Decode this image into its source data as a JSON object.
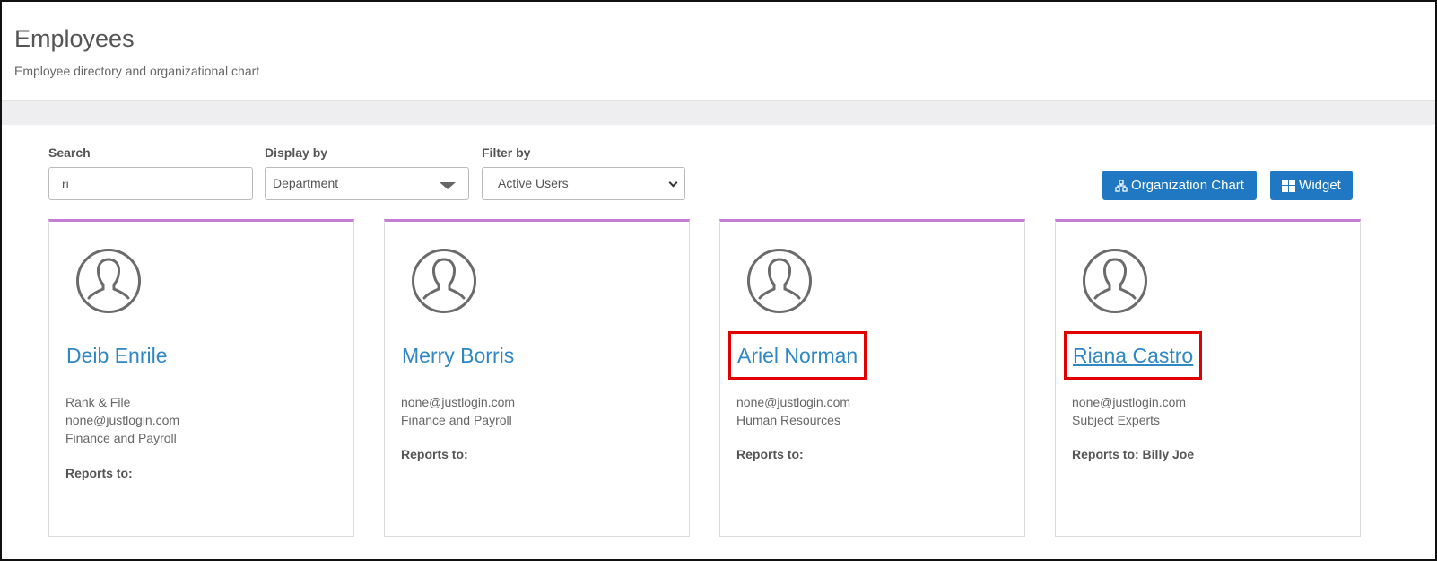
{
  "header": {
    "title": "Employees",
    "subtitle": "Employee directory and organizational chart"
  },
  "filters": {
    "search_label": "Search",
    "search_value": "ri",
    "display_label": "Display by",
    "display_value": "Department",
    "filter_label": "Filter by",
    "filter_value": "Active Users"
  },
  "actions": {
    "org_chart_label": "Organization Chart",
    "widget_label": "Widget"
  },
  "colors": {
    "accent": "#1f78c1",
    "card_top_border": "#c47fd4",
    "name_link": "#2f87c4",
    "highlight_box": "#e00000"
  },
  "employees": [
    {
      "name": "Deib Enrile",
      "lines": [
        "Rank & File",
        "none@justlogin.com",
        "Finance and Payroll"
      ],
      "reports_to": "Reports to:"
    },
    {
      "name": "Merry Borris",
      "lines": [
        "none@justlogin.com",
        "Finance and Payroll"
      ],
      "reports_to": "Reports to:"
    },
    {
      "name": "Ariel Norman",
      "lines": [
        "none@justlogin.com",
        "Human Resources"
      ],
      "reports_to": "Reports to:"
    },
    {
      "name": "Riana Castro",
      "lines": [
        "none@justlogin.com",
        "Subject Experts"
      ],
      "reports_to": "Reports to: Billy Joe"
    }
  ],
  "icons": {
    "avatar": "user-avatar-icon",
    "org_chart": "org-chart-icon",
    "widget": "grid-widget-icon"
  }
}
